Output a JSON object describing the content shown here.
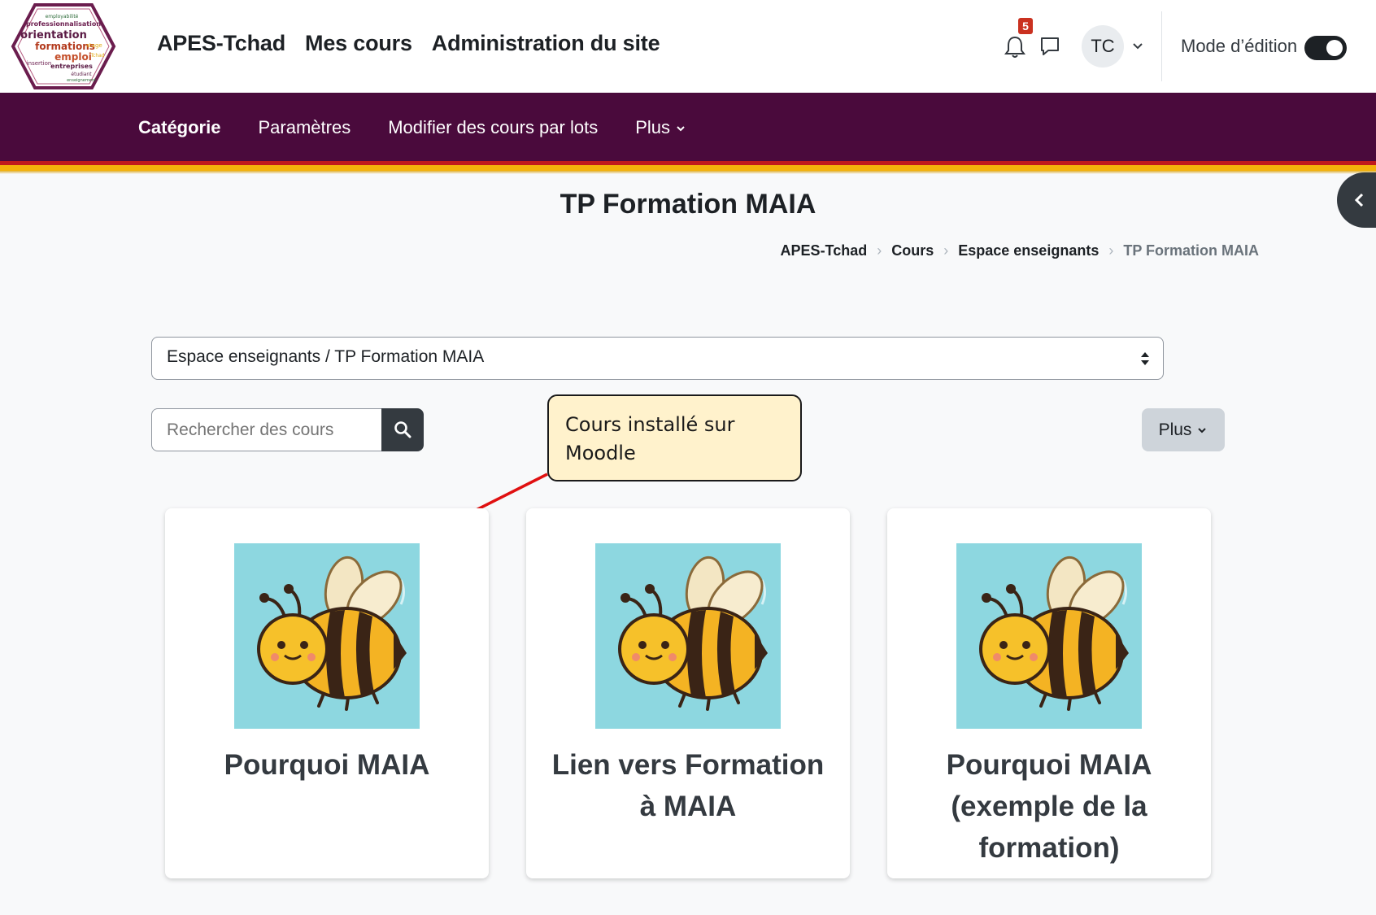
{
  "topbar": {
    "nav": [
      "APES-Tchad",
      "Mes cours",
      "Administration du site"
    ],
    "notification_count": "5",
    "user_initials": "TC",
    "edit_mode_label": "Mode d’édition",
    "edit_mode_on": true
  },
  "logo": {
    "words": [
      "employabilité",
      "professionnalisation",
      "orientation",
      "formations",
      "stage",
      "emploi",
      "insertion",
      "entreprises",
      "Tchad",
      "étudiant",
      "enseignement"
    ]
  },
  "secnav": {
    "items": [
      "Catégorie",
      "Paramètres",
      "Modifier des cours par lots",
      "Plus"
    ],
    "active": "Catégorie"
  },
  "page": {
    "title": "TP Formation MAIA",
    "breadcrumb": [
      "APES-Tchad",
      "Cours",
      "Espace enseignants",
      "TP Formation MAIA"
    ]
  },
  "category_select": {
    "value": "Espace enseignants / TP Formation MAIA"
  },
  "search": {
    "placeholder": "Rechercher des cours"
  },
  "plus_button": "Plus",
  "callout": {
    "text": "Cours installé sur Moodle"
  },
  "courses": [
    {
      "title": "Pourquoi MAIA",
      "image": "bee-illustration"
    },
    {
      "title": "Lien vers Formation à MAIA",
      "image": "bee-illustration"
    },
    {
      "title": "Pourquoi MAIA (exemple de la formation)",
      "image": "bee-illustration"
    }
  ],
  "colors": {
    "brand_purple": "#4a0a3c",
    "stripe_red": "#c0181c",
    "stripe_yellow": "#f3b10a",
    "callout_bg": "#fff2cc",
    "arrow_red": "#e01010",
    "card_image_bg": "#8dd7e0"
  }
}
